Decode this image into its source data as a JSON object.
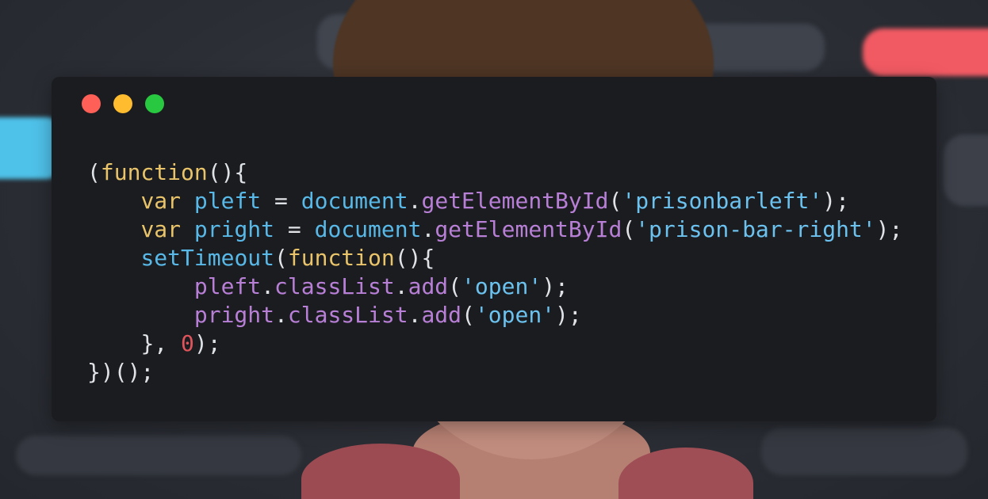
{
  "window": {
    "traffic_lights": [
      {
        "name": "close",
        "color": "#fe5f57"
      },
      {
        "name": "minimize",
        "color": "#febc2e"
      },
      {
        "name": "maximize",
        "color": "#28c840"
      }
    ]
  },
  "colors": {
    "background": "#1b1c1f",
    "plain": "#dfe2e7",
    "keyword": "#e9c46a",
    "identifier": "#58b9e8",
    "method": "#b77fd6",
    "string": "#6cc2ef",
    "number": "#e0555c"
  },
  "code": {
    "lines": [
      {
        "indent": 0,
        "tokens": [
          {
            "t": "plain",
            "v": "("
          },
          {
            "t": "keyword",
            "v": "function"
          },
          {
            "t": "plain",
            "v": "(){"
          }
        ]
      },
      {
        "indent": 4,
        "tokens": [
          {
            "t": "keyword",
            "v": "var"
          },
          {
            "t": "plain",
            "v": " "
          },
          {
            "t": "ident",
            "v": "pleft"
          },
          {
            "t": "plain",
            "v": " = "
          },
          {
            "t": "ident",
            "v": "document"
          },
          {
            "t": "plain",
            "v": "."
          },
          {
            "t": "method",
            "v": "getElementById"
          },
          {
            "t": "plain",
            "v": "("
          },
          {
            "t": "string",
            "v": "'prisonbarleft'"
          },
          {
            "t": "plain",
            "v": ");"
          }
        ]
      },
      {
        "indent": 4,
        "tokens": [
          {
            "t": "keyword",
            "v": "var"
          },
          {
            "t": "plain",
            "v": " "
          },
          {
            "t": "ident",
            "v": "pright"
          },
          {
            "t": "plain",
            "v": " = "
          },
          {
            "t": "ident",
            "v": "document"
          },
          {
            "t": "plain",
            "v": "."
          },
          {
            "t": "method",
            "v": "getElementById"
          },
          {
            "t": "plain",
            "v": "("
          },
          {
            "t": "string",
            "v": "'prison-bar-right'"
          },
          {
            "t": "plain",
            "v": ");"
          }
        ]
      },
      {
        "indent": 4,
        "tokens": [
          {
            "t": "ident",
            "v": "setTimeout"
          },
          {
            "t": "plain",
            "v": "("
          },
          {
            "t": "keyword",
            "v": "function"
          },
          {
            "t": "plain",
            "v": "(){"
          }
        ]
      },
      {
        "indent": 8,
        "tokens": [
          {
            "t": "method",
            "v": "pleft"
          },
          {
            "t": "plain",
            "v": "."
          },
          {
            "t": "method",
            "v": "classList"
          },
          {
            "t": "plain",
            "v": "."
          },
          {
            "t": "method",
            "v": "add"
          },
          {
            "t": "plain",
            "v": "("
          },
          {
            "t": "string",
            "v": "'open'"
          },
          {
            "t": "plain",
            "v": ");"
          }
        ]
      },
      {
        "indent": 8,
        "tokens": [
          {
            "t": "method",
            "v": "pright"
          },
          {
            "t": "plain",
            "v": "."
          },
          {
            "t": "method",
            "v": "classList"
          },
          {
            "t": "plain",
            "v": "."
          },
          {
            "t": "method",
            "v": "add"
          },
          {
            "t": "plain",
            "v": "("
          },
          {
            "t": "string",
            "v": "'open'"
          },
          {
            "t": "plain",
            "v": ");"
          }
        ]
      },
      {
        "indent": 4,
        "tokens": [
          {
            "t": "plain",
            "v": "}, "
          },
          {
            "t": "number",
            "v": "0"
          },
          {
            "t": "plain",
            "v": ");"
          }
        ]
      },
      {
        "indent": 0,
        "tokens": [
          {
            "t": "plain",
            "v": "})();"
          }
        ]
      }
    ]
  }
}
